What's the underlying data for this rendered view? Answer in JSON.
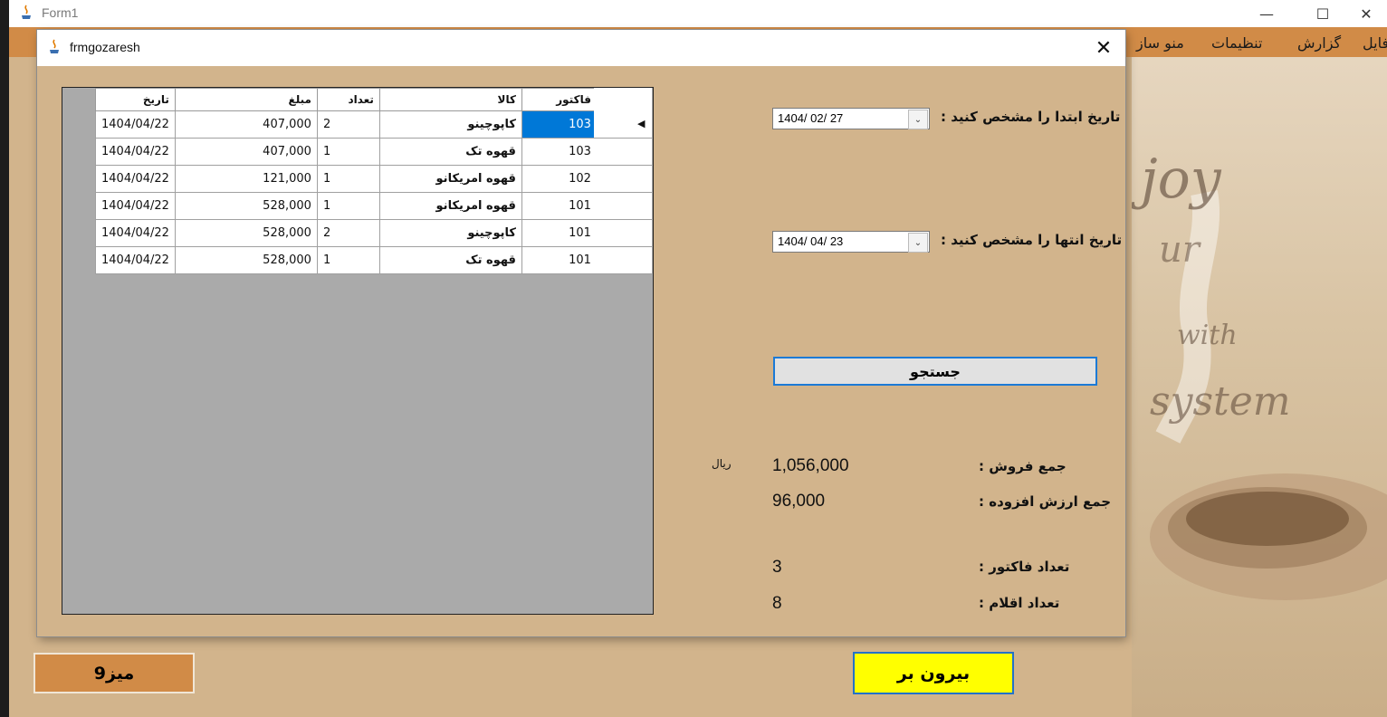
{
  "outer_window": {
    "title": "Form1",
    "menu": [
      "فایل",
      "گزارش",
      "تنظیمات",
      "منو ساز"
    ]
  },
  "background_text": [
    "joy",
    "ur",
    "with",
    "system"
  ],
  "dialog": {
    "title": "frmgozaresh",
    "grid": {
      "columns": [
        "فاکتور",
        "کالا",
        "تعداد",
        "مبلغ",
        "تاریخ"
      ],
      "rows": [
        {
          "factor": "103",
          "item": "کاپوچینو",
          "qty": "2",
          "amount": "407,000",
          "date": "1404/04/22"
        },
        {
          "factor": "103",
          "item": "قهوه تک",
          "qty": "1",
          "amount": "407,000",
          "date": "1404/04/22"
        },
        {
          "factor": "102",
          "item": "قهوه امریکانو",
          "qty": "1",
          "amount": "121,000",
          "date": "1404/04/22"
        },
        {
          "factor": "101",
          "item": "قهوه امریکانو",
          "qty": "1",
          "amount": "528,000",
          "date": "1404/04/22"
        },
        {
          "factor": "101",
          "item": "کاپوچینو",
          "qty": "2",
          "amount": "528,000",
          "date": "1404/04/22"
        },
        {
          "factor": "101",
          "item": "قهوه تک",
          "qty": "1",
          "amount": "528,000",
          "date": "1404/04/22"
        }
      ]
    },
    "start_date_label": "تاریخ ابتدا را مشخص کنید :",
    "start_date_value": "1404/ 02/ 27",
    "end_date_label": "تاریخ انتها را مشخص کنید :",
    "end_date_value": "1404/ 04/ 23",
    "search_label": "جستجو",
    "total_sales_label": "جمع فروش :",
    "total_sales_value": "1,056,000",
    "currency": "ریال",
    "vat_label": "جمع ارزش افزوده :",
    "vat_value": "96,000",
    "invoice_count_label": "تعداد فاکتور :",
    "invoice_count_value": "3",
    "items_count_label": "تعداد اقلام :",
    "items_count_value": "8"
  },
  "exit_label": "بیرون بر",
  "table_label": "میز9",
  "colors": {
    "menu_bar": "#d18b47",
    "panel": "#d2b48c",
    "exit_button": "#ffff00",
    "selected_cell": "#0078d7"
  }
}
